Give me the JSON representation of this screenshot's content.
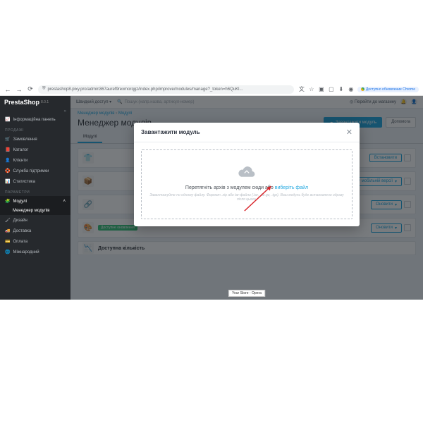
{
  "browser": {
    "url": "prestashop8.pixy.pro/admin367auref9rexmorqgz/index.php/improve/modules/manage?_token=h6QuKl...",
    "chrome_update": "Доступно обновление Chrome"
  },
  "brand": {
    "name": "PrestaShop",
    "version": "8.0.1"
  },
  "collapse": "«",
  "nav": {
    "dashboard": "Інформаційна панель",
    "section_sales": "ПРОДАЖІ",
    "orders": "Замовлення",
    "catalog": "Каталог",
    "customers": "Клієнти",
    "support": "Служба підтримки",
    "stats": "Статистика",
    "section_params": "ПАРАМЕТРИ",
    "modules": "Модулі",
    "modules_manager": "Менеджер модулів",
    "design": "Дизайн",
    "shipping": "Доставка",
    "payment": "Оплата",
    "international": "Міжнародний"
  },
  "topbar": {
    "quick": "Швидкий доступ ▾",
    "search_placeholder": "Пошук (напр.назва, артикул-номер)",
    "view_store": "Перейти до магазину"
  },
  "breadcrumb": {
    "a": "Менеджер модулів",
    "b": "Модулі"
  },
  "page": {
    "title": "Менеджер модулів",
    "upload": "Завантажити модуль",
    "help": "Допомога"
  },
  "tabs": {
    "modules": "Модулі",
    "other1": "",
    "other2": ""
  },
  "actions": {
    "install": "Встановити",
    "disable_mobile": "Вимкнути у мобільній версії",
    "update": "Оновити"
  },
  "badge": "Доступне оновлення",
  "last_title": "Доступна кількість",
  "modal": {
    "title": "Завантажити модуль",
    "drop_text": "Перетягніть архів з модулем сюди або ",
    "drop_link": "виберіть файл",
    "hint": "Завантажуйте по одному файлу. Формат .zip або tar-файли (.tar, .tar.gz, .tgz). Ваш модуль буде встановлено одразу після цього."
  },
  "tooltip": "Your Store - Opera"
}
